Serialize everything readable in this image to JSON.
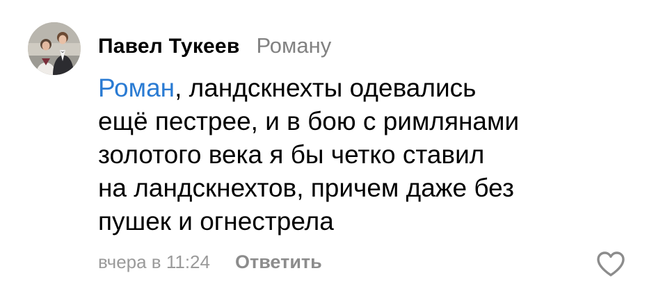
{
  "comment": {
    "author": "Павел Тукеев",
    "reply_to": "Роману",
    "mention": "Роман",
    "text_lines": [
      ", ландскнехты одевались",
      "ещё пестрее, и в бою с римлянами",
      "золотого века я бы четко ставил",
      "на ландскнехтов, причем даже без",
      "пушек и огнестрела"
    ],
    "time": "вчера в 11:24",
    "reply_label": "Ответить"
  },
  "icons": {
    "like": "heart-outline-icon",
    "avatar": "user-photo"
  },
  "colors": {
    "mention": "#2a7bd3",
    "secondary": "#828282",
    "icon": "#8c8c8c"
  }
}
